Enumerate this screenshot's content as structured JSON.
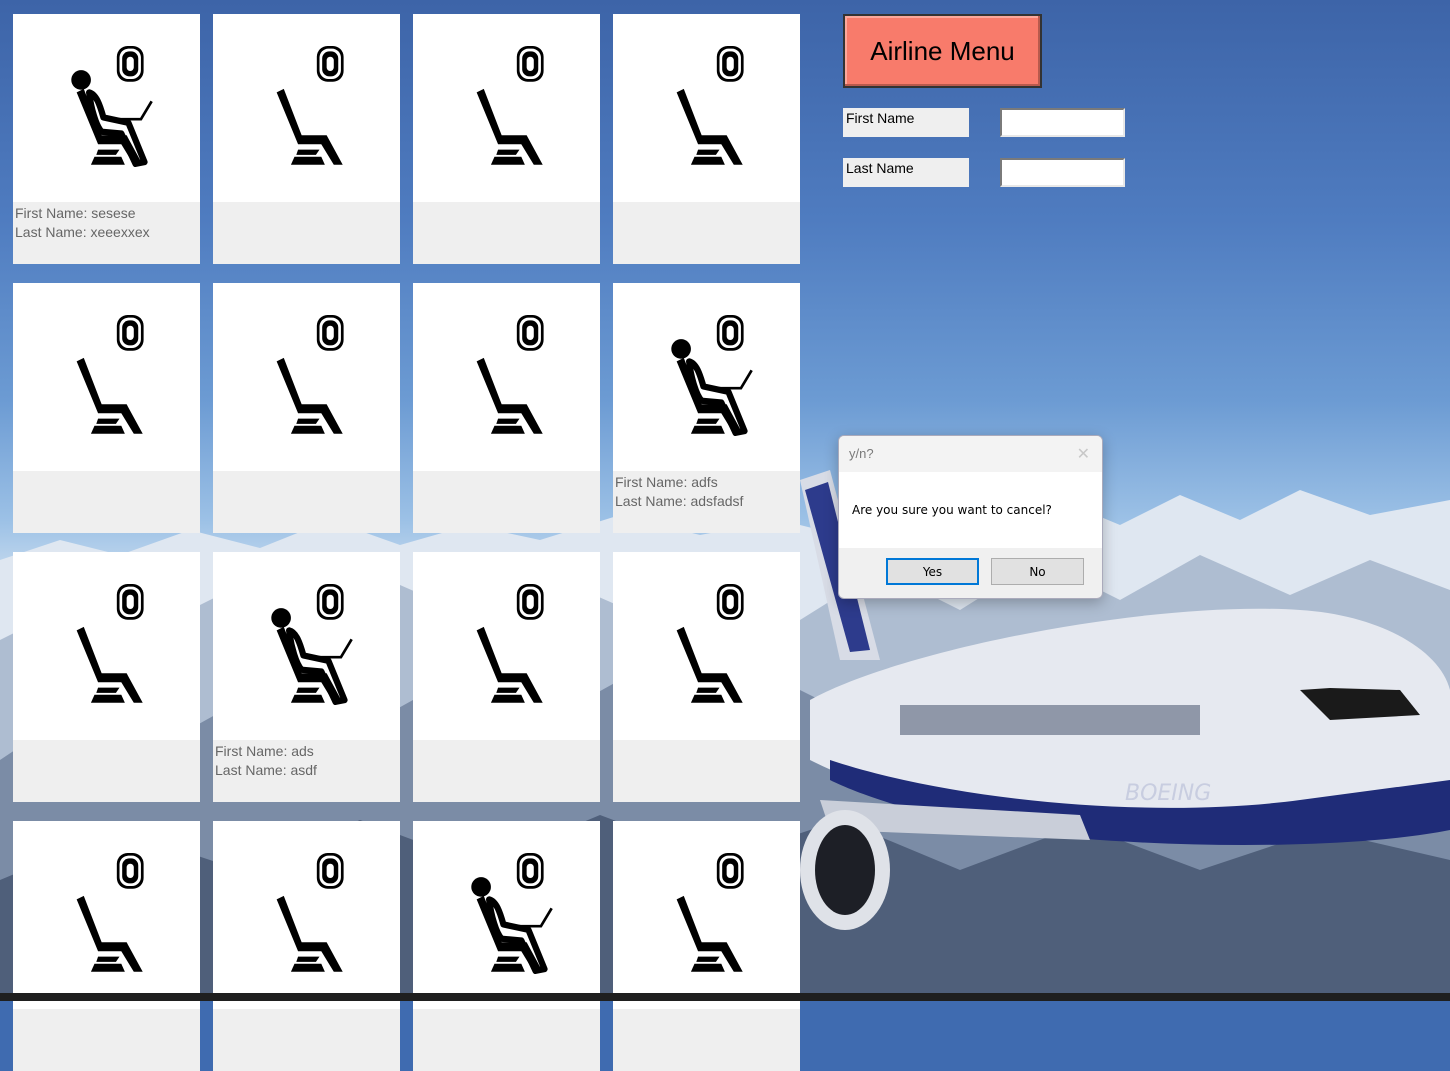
{
  "menu": {
    "label": "Airline Menu"
  },
  "form": {
    "first_name_label": "First Name",
    "first_name_value": "",
    "last_name_label": "Last Name",
    "last_name_value": ""
  },
  "dialog": {
    "title": "y/n?",
    "message": "Are you sure you want to cancel?",
    "yes_label": "Yes",
    "no_label": "No",
    "close_glyph": "✕"
  },
  "seats": [
    {
      "occupied": true,
      "first": "First Name: sesese",
      "last": "Last Name: xeeexxex"
    },
    {
      "occupied": false,
      "first": "",
      "last": ""
    },
    {
      "occupied": false,
      "first": "",
      "last": ""
    },
    {
      "occupied": false,
      "first": "",
      "last": ""
    },
    {
      "occupied": false,
      "first": "",
      "last": ""
    },
    {
      "occupied": false,
      "first": "",
      "last": ""
    },
    {
      "occupied": false,
      "first": "",
      "last": ""
    },
    {
      "occupied": true,
      "first": "First Name: adfs",
      "last": "Last Name: adsfadsf"
    },
    {
      "occupied": false,
      "first": "",
      "last": ""
    },
    {
      "occupied": true,
      "first": "First Name: ads",
      "last": "Last Name: asdf"
    },
    {
      "occupied": false,
      "first": "",
      "last": ""
    },
    {
      "occupied": false,
      "first": "",
      "last": ""
    },
    {
      "occupied": false,
      "first": "",
      "last": ""
    },
    {
      "occupied": false,
      "first": "",
      "last": ""
    },
    {
      "occupied": true,
      "first": "",
      "last": ""
    },
    {
      "occupied": false,
      "first": "",
      "last": ""
    }
  ],
  "icons": {
    "empty": "empty-seat-icon",
    "occupied": "occupied-seat-icon"
  },
  "colors": {
    "menu_button": "#f87b6b",
    "card": "#ffffff",
    "card_info": "#efefef",
    "dialog_default_border": "#0078d7"
  }
}
